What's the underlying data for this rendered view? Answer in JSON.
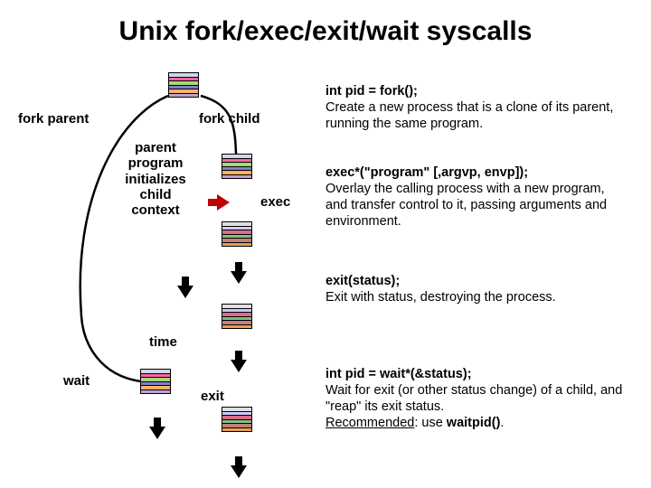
{
  "title": "Unix fork/exec/exit/wait syscalls",
  "labels": {
    "fork_parent": "fork parent",
    "fork_child": "fork child",
    "parent_init": "parent\nprogram\ninitializes\nchild\ncontext",
    "exec": "exec",
    "time": "time",
    "wait": "wait",
    "exit": "exit"
  },
  "desc": {
    "fork_sig": "int pid = fork();",
    "fork_txt": "Create a new process that is a clone of its parent, running the same program.",
    "exec_sig": "exec*(\"program\" [,argvp, envp]);",
    "exec_txt": "Overlay the calling process with a new program, and transfer control to it, passing arguments and environment.",
    "exit_sig": "exit(status);",
    "exit_txt": "Exit with status, destroying the process.",
    "wait_sig": "int pid = wait*(&status);",
    "wait_txt_a": "Wait for exit (or other status change) of a child, and \"reap\" its exit status.",
    "wait_txt_b_pre": "Recommended",
    "wait_txt_b_mid": ": use ",
    "wait_txt_b_fn": "waitpid()",
    "wait_txt_b_post": "."
  }
}
